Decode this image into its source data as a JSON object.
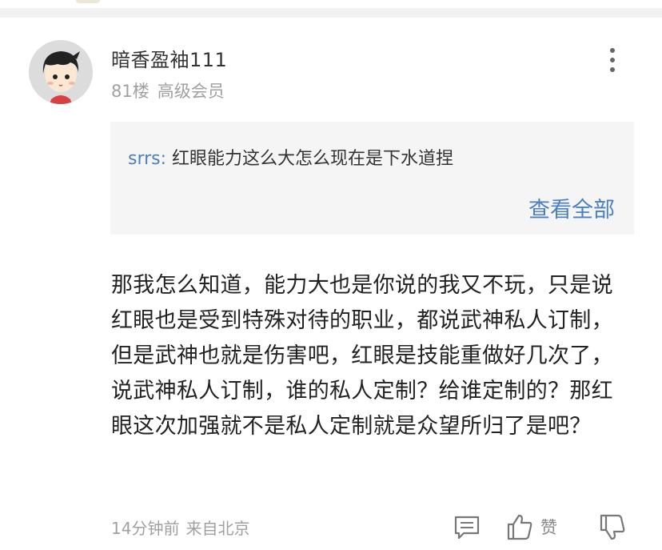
{
  "comment": {
    "username": "暗香盈袖111",
    "floor": "81楼",
    "member_level": "高级会员",
    "quote": {
      "author": "srrs:",
      "text": "红眼能力这么大怎么现在是下水道捏",
      "view_all": "查看全部"
    },
    "body": "那我怎么知道，能力大也是你说的我又不玩，只是说红眼也是受到特殊对待的职业，都说武神私人订制，但是武神也就是伤害吧，红眼是技能重做好几次了，说武神私人订制，谁的私人定制？给谁定制的？那红眼这次加强就不是私人定制就是众望所归了是吧？",
    "time": "14分钟前",
    "source": "来自北京",
    "like_label": "赞"
  },
  "icons": {
    "avatar": "cartoon-avatar",
    "more": "more-vertical-icon",
    "reply": "reply-comment-icon",
    "like": "thumbs-up-icon",
    "dislike": "thumbs-down-icon"
  },
  "colors": {
    "link": "#4a7fc1",
    "quote_bg": "#f5f5f5",
    "muted": "#a0a0a0"
  }
}
